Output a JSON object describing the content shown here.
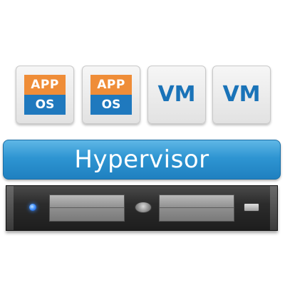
{
  "tiles": [
    {
      "type": "app-os",
      "app_label": "APP",
      "os_label": "OS"
    },
    {
      "type": "app-os",
      "app_label": "APP",
      "os_label": "OS"
    },
    {
      "type": "vm",
      "label": "VM"
    },
    {
      "type": "vm",
      "label": "VM"
    }
  ],
  "hypervisor": {
    "label": "Hypervisor"
  },
  "colors": {
    "app_orange": "#ef8d38",
    "os_blue": "#1f79be",
    "vm_text_blue": "#1a73b8",
    "hypervisor_blue": "#2e95d2",
    "server_dark": "#2c2c2c",
    "led_blue": "#3b8cff"
  }
}
